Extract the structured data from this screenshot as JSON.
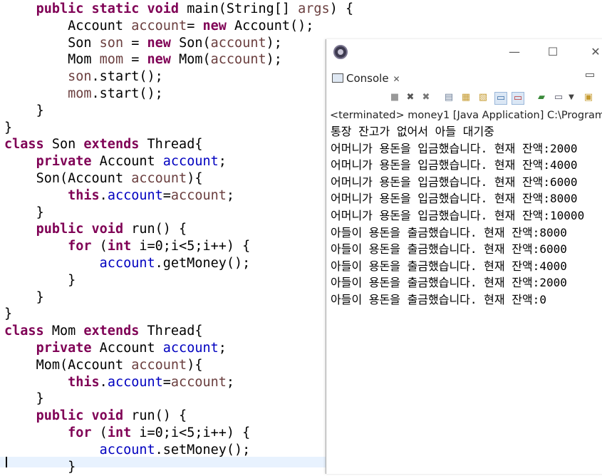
{
  "editor": {
    "lines": [
      {
        "i": "    ",
        "parts": [
          [
            "kw",
            "public "
          ],
          [
            "kw",
            "static "
          ],
          [
            "kw",
            "void "
          ],
          [
            "",
            "main(String[] "
          ],
          [
            "var",
            "args"
          ],
          [
            "",
            ") {"
          ]
        ]
      },
      {
        "i": "        ",
        "parts": [
          [
            "",
            "Account "
          ],
          [
            "var",
            "account"
          ],
          [
            "",
            "= "
          ],
          [
            "kw",
            "new "
          ],
          [
            "",
            "Account();"
          ]
        ]
      },
      {
        "i": "        ",
        "parts": [
          [
            "",
            "Son "
          ],
          [
            "var",
            "son"
          ],
          [
            "",
            " = "
          ],
          [
            "kw",
            "new "
          ],
          [
            "",
            "Son("
          ],
          [
            "var",
            "account"
          ],
          [
            "",
            ");"
          ]
        ]
      },
      {
        "i": "        ",
        "parts": [
          [
            "",
            "Mom "
          ],
          [
            "var",
            "mom"
          ],
          [
            "",
            " = "
          ],
          [
            "kw",
            "new "
          ],
          [
            "",
            "Mom("
          ],
          [
            "var",
            "account"
          ],
          [
            "",
            ");"
          ]
        ]
      },
      {
        "i": "        ",
        "parts": [
          [
            "var",
            "son"
          ],
          [
            "",
            ".start();"
          ]
        ]
      },
      {
        "i": "        ",
        "parts": [
          [
            "var",
            "mom"
          ],
          [
            "",
            ".start();"
          ]
        ]
      },
      {
        "i": "    ",
        "parts": [
          [
            "",
            "}"
          ]
        ]
      },
      {
        "i": "",
        "parts": [
          [
            "",
            "}"
          ]
        ]
      },
      {
        "i": "",
        "parts": [
          [
            "kw",
            "class "
          ],
          [
            "",
            "Son "
          ],
          [
            "kw",
            "extends "
          ],
          [
            "",
            "Thread{"
          ]
        ]
      },
      {
        "i": "    ",
        "parts": [
          [
            "kw",
            "private "
          ],
          [
            "",
            "Account "
          ],
          [
            "fld",
            "account"
          ],
          [
            "",
            ";"
          ]
        ]
      },
      {
        "i": "    ",
        "parts": [
          [
            "",
            "Son(Account "
          ],
          [
            "var",
            "account"
          ],
          [
            "",
            "){"
          ]
        ]
      },
      {
        "i": "        ",
        "parts": [
          [
            "kw",
            "this"
          ],
          [
            "",
            "."
          ],
          [
            "fld",
            "account"
          ],
          [
            "",
            "="
          ],
          [
            "var",
            "account"
          ],
          [
            "",
            ";"
          ]
        ]
      },
      {
        "i": "    ",
        "parts": [
          [
            "",
            "}"
          ]
        ]
      },
      {
        "i": "    ",
        "parts": [
          [
            "kw",
            "public "
          ],
          [
            "kw",
            "void "
          ],
          [
            "",
            "run() {"
          ]
        ]
      },
      {
        "i": "        ",
        "parts": [
          [
            "kw",
            "for "
          ],
          [
            "",
            "("
          ],
          [
            "kw",
            "int "
          ],
          [
            "",
            "i=0;i<5;i++) {"
          ]
        ]
      },
      {
        "i": "            ",
        "parts": [
          [
            "fld",
            "account"
          ],
          [
            "",
            ".getMoney();"
          ]
        ]
      },
      {
        "i": "        ",
        "parts": [
          [
            "",
            "}"
          ]
        ]
      },
      {
        "i": "    ",
        "parts": [
          [
            "",
            "}"
          ]
        ]
      },
      {
        "i": "",
        "parts": [
          [
            "",
            "}"
          ]
        ]
      },
      {
        "i": "",
        "parts": [
          [
            "kw",
            "class "
          ],
          [
            "",
            "Mom "
          ],
          [
            "kw",
            "extends "
          ],
          [
            "",
            "Thread{"
          ]
        ]
      },
      {
        "i": "    ",
        "parts": [
          [
            "kw",
            "private "
          ],
          [
            "",
            "Account "
          ],
          [
            "fld",
            "account"
          ],
          [
            "",
            ";"
          ]
        ]
      },
      {
        "i": "    ",
        "parts": [
          [
            "",
            "Mom(Account "
          ],
          [
            "var",
            "account"
          ],
          [
            "",
            "){"
          ]
        ]
      },
      {
        "i": "        ",
        "parts": [
          [
            "kw",
            "this"
          ],
          [
            "",
            "."
          ],
          [
            "fld",
            "account"
          ],
          [
            "",
            "="
          ],
          [
            "var",
            "account"
          ],
          [
            "",
            ";"
          ]
        ]
      },
      {
        "i": "    ",
        "parts": [
          [
            "",
            "}"
          ]
        ]
      },
      {
        "i": "    ",
        "parts": [
          [
            "kw",
            "public "
          ],
          [
            "kw",
            "void "
          ],
          [
            "",
            "run() {"
          ]
        ]
      },
      {
        "i": "        ",
        "parts": [
          [
            "kw",
            "for "
          ],
          [
            "",
            "("
          ],
          [
            "kw",
            "int "
          ],
          [
            "",
            "i=0;i<5;i++) {"
          ]
        ]
      },
      {
        "i": "            ",
        "parts": [
          [
            "fld",
            "account"
          ],
          [
            "",
            ".setMoney();"
          ]
        ]
      },
      {
        "i": "        ",
        "parts": [
          [
            "",
            "}"
          ]
        ]
      }
    ]
  },
  "console": {
    "window_controls": {
      "minimize": "—",
      "maximize": "☐",
      "close": "✕"
    },
    "tab_label": "Console",
    "tab_close": "✕",
    "status": "<terminated> money1 [Java Application] C:\\Program",
    "output": [
      "통장 잔고가 없어서 아들 대기중",
      "어머니가 용돈을 입금했습니다. 현재 잔액:2000",
      "어머니가 용돈을 입금했습니다. 현재 잔액:4000",
      "어머니가 용돈을 입금했습니다. 현재 잔액:6000",
      "어머니가 용돈을 입금했습니다. 현재 잔액:8000",
      "어머니가 용돈을 입금했습니다. 현재 잔액:10000",
      "아들이 용돈을 출금했습니다. 현재 잔액:8000",
      "아들이 용돈을 출금했습니다. 현재 잔액:6000",
      "아들이 용돈을 출금했습니다. 현재 잔액:4000",
      "아들이 용돈을 출금했습니다. 현재 잔액:2000",
      "아들이 용돈을 출금했습니다. 현재 잔액:0"
    ],
    "toolbar_icons": [
      "terminate-icon",
      "remove-launch-icon",
      "remove-all-icon",
      "clear-console-icon",
      "scroll-lock-icon",
      "word-wrap-icon",
      "show-stdout-icon",
      "show-stderr-icon",
      "pin-console-icon",
      "display-console-icon",
      "dropdown-icon",
      "open-console-icon"
    ]
  },
  "colors": {
    "keyword": "#7f0055",
    "field": "#0000c0",
    "variable": "#6a3e3e"
  }
}
